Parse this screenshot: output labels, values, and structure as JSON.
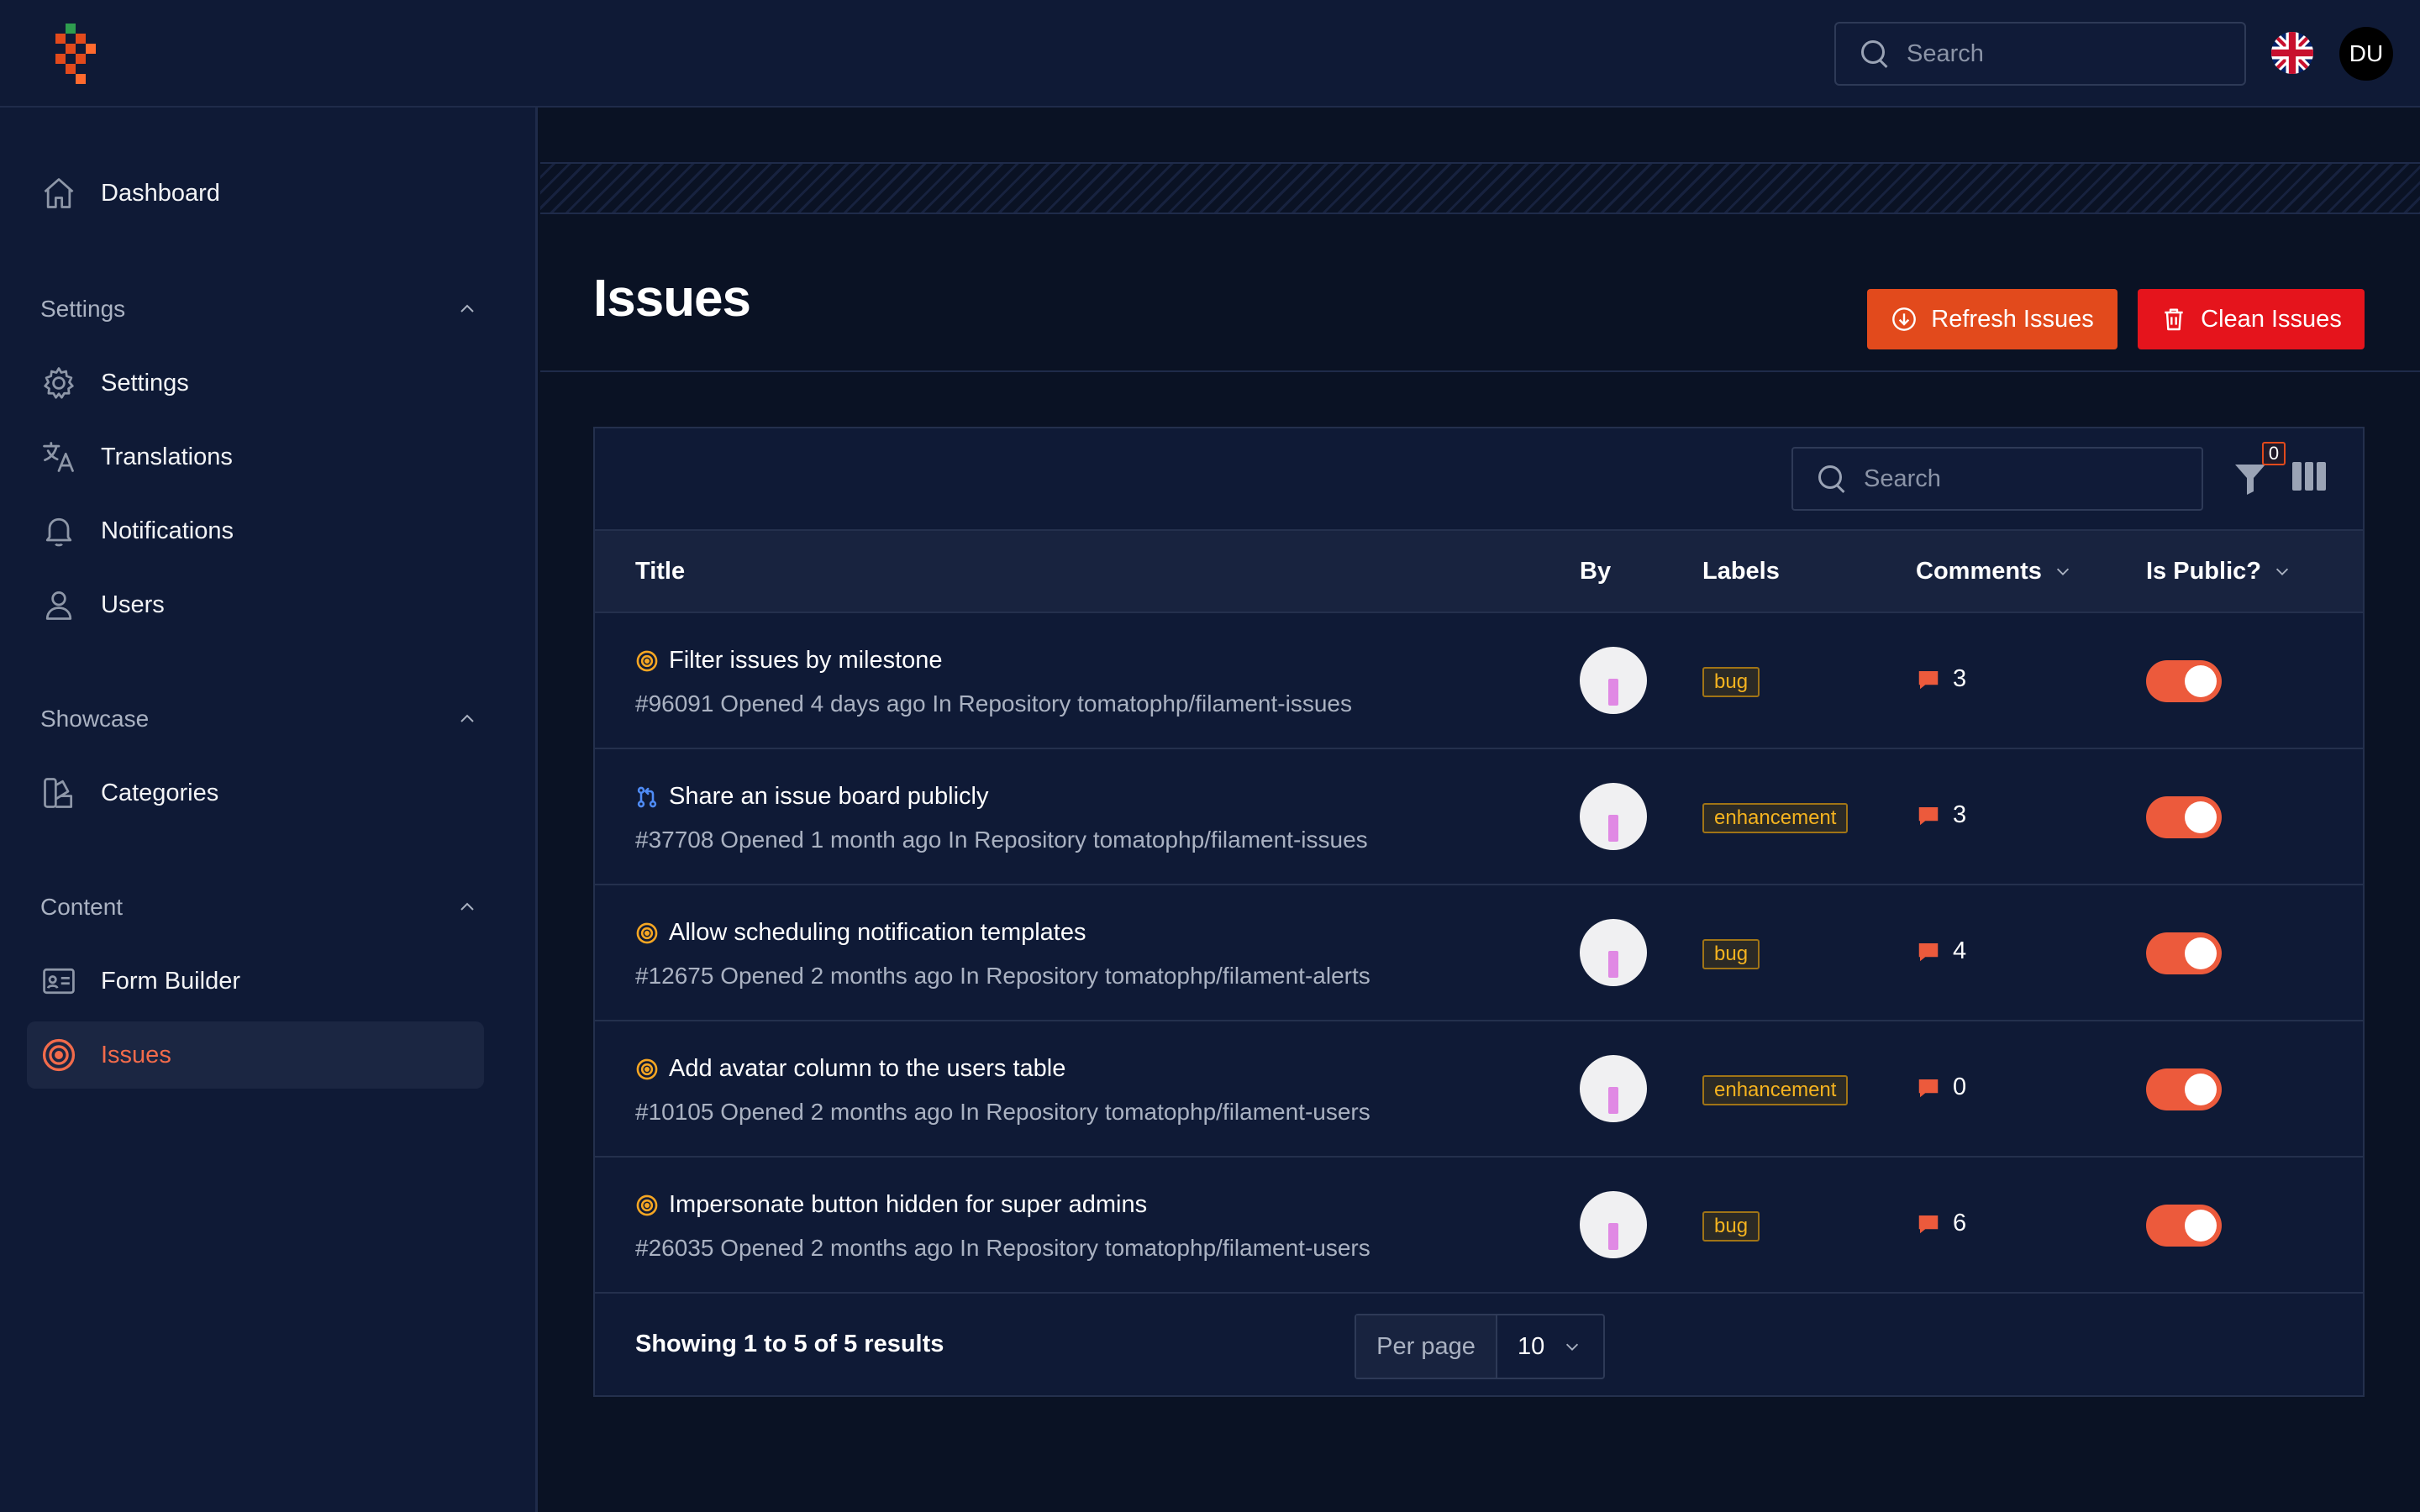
{
  "topbar": {
    "search_placeholder": "Search",
    "user_initials": "DU",
    "logo_colors": [
      "#2e9d4f",
      "#e24a1c",
      "#ff6a2e"
    ]
  },
  "sidebar": {
    "top_items": [
      {
        "label": "Dashboard",
        "icon": "home-icon"
      }
    ],
    "groups": [
      {
        "title": "Settings",
        "items": [
          {
            "label": "Settings",
            "icon": "cog-icon"
          },
          {
            "label": "Translations",
            "icon": "translate-icon"
          },
          {
            "label": "Notifications",
            "icon": "bell-icon"
          },
          {
            "label": "Users",
            "icon": "user-icon"
          }
        ]
      },
      {
        "title": "Showcase",
        "items": [
          {
            "label": "Categories",
            "icon": "swatch-icon"
          }
        ]
      },
      {
        "title": "Content",
        "items": [
          {
            "label": "Form Builder",
            "icon": "id-card-icon"
          },
          {
            "label": "Issues",
            "icon": "target-icon",
            "active": true
          }
        ]
      }
    ]
  },
  "page": {
    "title": "Issues",
    "refresh_label": "Refresh Issues",
    "clean_label": "Clean Issues"
  },
  "table": {
    "search_placeholder": "Search",
    "filter_count": "0",
    "columns": {
      "title": "Title",
      "by": "By",
      "labels": "Labels",
      "comments": "Comments",
      "is_public": "Is Public?"
    },
    "rows": [
      {
        "type": "issue",
        "title": "Filter issues by milestone",
        "meta": "#96091 Opened 4 days ago In Repository tomatophp/filament-issues",
        "label": "bug",
        "comments": "3",
        "public": true
      },
      {
        "type": "pull",
        "title": "Share an issue board publicly",
        "meta": "#37708 Opened 1 month ago In Repository tomatophp/filament-issues",
        "label": "enhancement",
        "comments": "3",
        "public": true
      },
      {
        "type": "issue",
        "title": "Allow scheduling notification templates",
        "meta": "#12675 Opened 2 months ago In Repository tomatophp/filament-alerts",
        "label": "bug",
        "comments": "4",
        "public": true
      },
      {
        "type": "issue",
        "title": "Add avatar column to the users table",
        "meta": "#10105 Opened 2 months ago In Repository tomatophp/filament-users",
        "label": "enhancement",
        "comments": "0",
        "public": true
      },
      {
        "type": "issue",
        "title": "Impersonate button hidden for super admins",
        "meta": "#26035 Opened 2 months ago In Repository tomatophp/filament-users",
        "label": "bug",
        "comments": "6",
        "public": true
      }
    ],
    "footer": {
      "showing": "Showing 1 to 5 of 5 results",
      "per_page_label": "Per page",
      "per_page_value": "10"
    }
  },
  "colors": {
    "accent": "#e24a1c",
    "danger": "#e5141c",
    "toggle_on": "#ec5a3c",
    "label_text": "#f5b31f",
    "issue_icon": "#f5a623",
    "pull_icon": "#4f8cf7"
  }
}
